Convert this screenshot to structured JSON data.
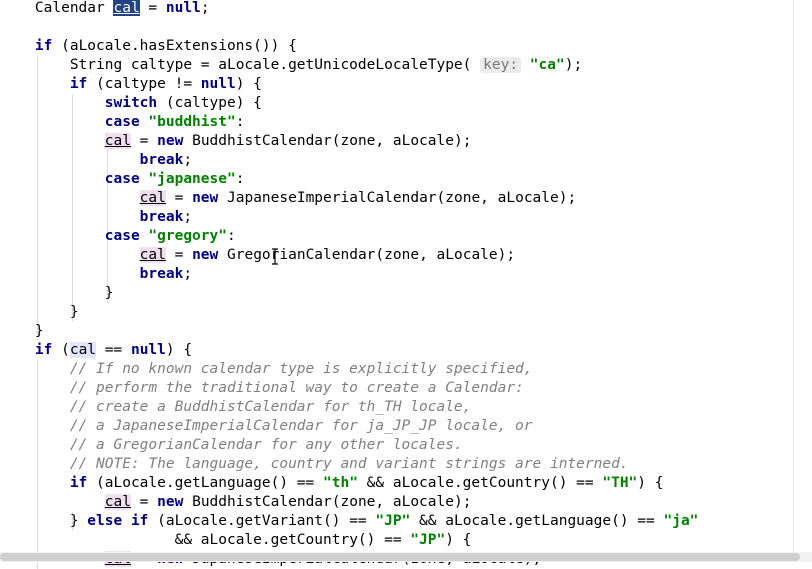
{
  "lines": [
    {
      "indent": 4,
      "tokens": [
        {
          "t": "Calendar "
        },
        {
          "t": "cal",
          "c": "sel"
        },
        {
          "t": " = "
        },
        {
          "t": "null",
          "c": "kw"
        },
        {
          "t": ";"
        }
      ]
    },
    {
      "indent": 0,
      "tokens": []
    },
    {
      "indent": 4,
      "tokens": [
        {
          "t": "if",
          "c": "kw"
        },
        {
          "t": " (aLocale.hasExtensions()) {"
        }
      ]
    },
    {
      "indent": 8,
      "tokens": [
        {
          "t": "String caltype = aLocale.getUnicodeLocaleType( "
        },
        {
          "t": "key:",
          "c": "hint"
        },
        {
          "t": " "
        },
        {
          "t": "\"ca\"",
          "c": "str"
        },
        {
          "t": ");"
        }
      ]
    },
    {
      "indent": 8,
      "tokens": [
        {
          "t": "if",
          "c": "kw"
        },
        {
          "t": " (caltype != "
        },
        {
          "t": "null",
          "c": "kw"
        },
        {
          "t": ") {"
        }
      ]
    },
    {
      "indent": 12,
      "tokens": [
        {
          "t": "switch",
          "c": "kw"
        },
        {
          "t": " (caltype) {"
        }
      ]
    },
    {
      "indent": 12,
      "tokens": [
        {
          "t": "case ",
          "c": "kw"
        },
        {
          "t": "\"buddhist\"",
          "c": "str"
        },
        {
          "t": ":"
        }
      ]
    },
    {
      "indent": 12,
      "tokens": [
        {
          "t": "cal",
          "c": "var"
        },
        {
          "t": " = "
        },
        {
          "t": "new",
          "c": "kw"
        },
        {
          "t": " BuddhistCalendar(zone, aLocale);"
        }
      ]
    },
    {
      "indent": 16,
      "tokens": [
        {
          "t": "break",
          "c": "kw"
        },
        {
          "t": ";"
        }
      ]
    },
    {
      "indent": 12,
      "tokens": [
        {
          "t": "case ",
          "c": "kw"
        },
        {
          "t": "\"japanese\"",
          "c": "str"
        },
        {
          "t": ":"
        }
      ]
    },
    {
      "indent": 16,
      "tokens": [
        {
          "t": "cal",
          "c": "var"
        },
        {
          "t": " = "
        },
        {
          "t": "new",
          "c": "kw"
        },
        {
          "t": " JapaneseImperialCalendar(zone, aLocale);"
        }
      ]
    },
    {
      "indent": 16,
      "tokens": [
        {
          "t": "break",
          "c": "kw"
        },
        {
          "t": ";"
        }
      ]
    },
    {
      "indent": 12,
      "tokens": [
        {
          "t": "case ",
          "c": "kw"
        },
        {
          "t": "\"gregory\"",
          "c": "str"
        },
        {
          "t": ":"
        }
      ]
    },
    {
      "indent": 16,
      "tokens": [
        {
          "t": "cal",
          "c": "var"
        },
        {
          "t": " = "
        },
        {
          "t": "new",
          "c": "kw"
        },
        {
          "t": " GregorianCalendar(zone, aLocale);"
        }
      ]
    },
    {
      "indent": 16,
      "tokens": [
        {
          "t": "break",
          "c": "kw"
        },
        {
          "t": ";"
        }
      ]
    },
    {
      "indent": 12,
      "tokens": [
        {
          "t": "}"
        }
      ]
    },
    {
      "indent": 8,
      "tokens": [
        {
          "t": "}"
        }
      ]
    },
    {
      "indent": 4,
      "tokens": [
        {
          "t": "}"
        }
      ]
    },
    {
      "indent": 4,
      "tokens": [
        {
          "t": "if",
          "c": "kw"
        },
        {
          "t": " ("
        },
        {
          "t": "cal",
          "c": "ref"
        },
        {
          "t": " == "
        },
        {
          "t": "null",
          "c": "kw"
        },
        {
          "t": ") {"
        }
      ]
    },
    {
      "indent": 8,
      "tokens": [
        {
          "t": "// If no known calendar type is explicitly specified,",
          "c": "cm"
        }
      ]
    },
    {
      "indent": 8,
      "tokens": [
        {
          "t": "// perform the traditional way to create a Calendar:",
          "c": "cm"
        }
      ]
    },
    {
      "indent": 8,
      "tokens": [
        {
          "t": "// create a BuddhistCalendar for th_TH locale,",
          "c": "cm"
        }
      ]
    },
    {
      "indent": 8,
      "tokens": [
        {
          "t": "// a JapaneseImperialCalendar for ja_JP_JP locale, or",
          "c": "cm"
        }
      ]
    },
    {
      "indent": 8,
      "tokens": [
        {
          "t": "// a GregorianCalendar for any other locales.",
          "c": "cm"
        }
      ]
    },
    {
      "indent": 8,
      "tokens": [
        {
          "t": "// NOTE: The language, country and variant strings are interned.",
          "c": "cm"
        }
      ]
    },
    {
      "indent": 8,
      "tokens": [
        {
          "t": "if",
          "c": "kw"
        },
        {
          "t": " (aLocale.getLanguage() == "
        },
        {
          "t": "\"th\"",
          "c": "str"
        },
        {
          "t": " && aLocale.getCountry() == "
        },
        {
          "t": "\"TH\"",
          "c": "str"
        },
        {
          "t": ") {"
        }
      ]
    },
    {
      "indent": 12,
      "tokens": [
        {
          "t": "cal",
          "c": "var"
        },
        {
          "t": " = "
        },
        {
          "t": "new",
          "c": "kw"
        },
        {
          "t": " BuddhistCalendar(zone, aLocale);"
        }
      ]
    },
    {
      "indent": 8,
      "tokens": [
        {
          "t": "} "
        },
        {
          "t": "else if",
          "c": "kw"
        },
        {
          "t": " (aLocale.getVariant() == "
        },
        {
          "t": "\"JP\"",
          "c": "str"
        },
        {
          "t": " && aLocale.getLanguage() == "
        },
        {
          "t": "\"ja\"",
          "c": "str"
        }
      ]
    },
    {
      "indent": 20,
      "tokens": [
        {
          "t": "&& aLocale.getCountry() == "
        },
        {
          "t": "\"JP\"",
          "c": "str"
        },
        {
          "t": ") {"
        }
      ]
    },
    {
      "indent": 12,
      "tokens": [
        {
          "t": "cal",
          "c": "var"
        },
        {
          "t": " = "
        },
        {
          "t": "new",
          "c": "kw"
        },
        {
          "t": " JapaneseImperialCalendar(zone, aLocale);"
        }
      ]
    }
  ],
  "guides": [
    {
      "col": 4,
      "from": 3,
      "to": 18
    },
    {
      "col": 8,
      "from": 5,
      "to": 17
    },
    {
      "col": 12,
      "from": 7,
      "to": 16
    },
    {
      "col": 4,
      "from": 19,
      "to": 30
    },
    {
      "col": 8,
      "from": 27,
      "to": 28
    }
  ],
  "colors": {
    "keyword": "#000080",
    "string": "#008000",
    "comment": "#808080",
    "selection": "#214283",
    "varHighlight": "#f0dff0"
  },
  "icons": {
    "cursor": "text-cursor-icon"
  }
}
